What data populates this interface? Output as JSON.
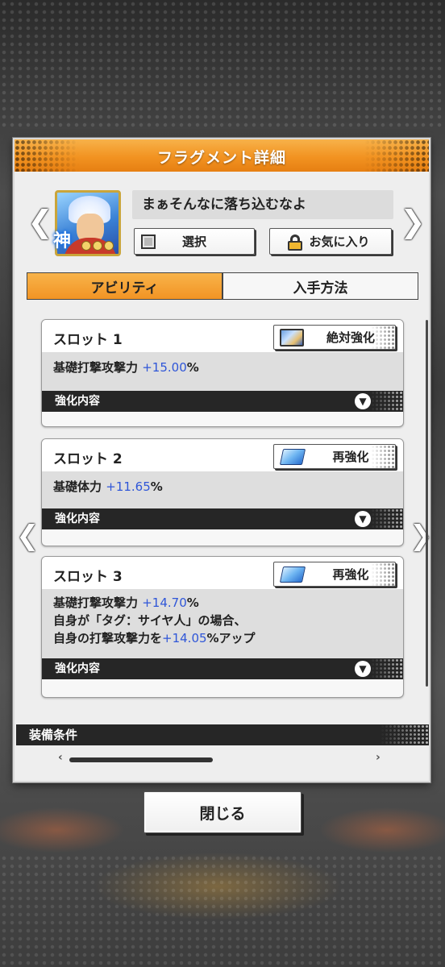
{
  "header": {
    "title": "フラグメント詳細"
  },
  "fragment": {
    "name": "まぁそんなに落ち込むなよ",
    "badge": "神",
    "star_count": 3
  },
  "nav": {
    "prev_glyph": "❮",
    "next_glyph": "❯"
  },
  "actions": {
    "select_label": "選択",
    "favorite_label": "お気に入り"
  },
  "tabs": [
    {
      "label": "アビリティ",
      "active": true
    },
    {
      "label": "入手方法",
      "active": false
    }
  ],
  "slots": [
    {
      "title": "スロット 1",
      "button_label": "絶対強化",
      "button_icon": "card-icon",
      "lines": [
        {
          "prefix": "基礎打撃攻撃力 ",
          "value": "+15.00",
          "suffix": "%"
        }
      ],
      "detail_label": "強化内容"
    },
    {
      "title": "スロット 2",
      "button_label": "再強化",
      "button_icon": "book-icon",
      "lines": [
        {
          "prefix": "基礎体力 ",
          "value": "+11.65",
          "suffix": "%"
        }
      ],
      "detail_label": "強化内容"
    },
    {
      "title": "スロット 3",
      "button_label": "再強化",
      "button_icon": "book-icon",
      "lines": [
        {
          "prefix": "基礎打撃攻撃力 ",
          "value": "+14.70",
          "suffix": "%"
        },
        {
          "prefix": "自身が「タグ：サイヤ人」の場合、",
          "value": "",
          "suffix": ""
        },
        {
          "prefix": "自身の打撃攻撃力を",
          "value": "+14.05",
          "suffix": "%アップ"
        }
      ],
      "detail_label": "強化内容"
    }
  ],
  "equip_condition_label": "装備条件",
  "bottom_hints": {
    "left": "‹",
    "right": "›"
  },
  "close_label": "閉じる",
  "colors": {
    "accent_orange": "#f29321",
    "value_blue": "#2f56d8",
    "dark_bar": "#262626"
  }
}
